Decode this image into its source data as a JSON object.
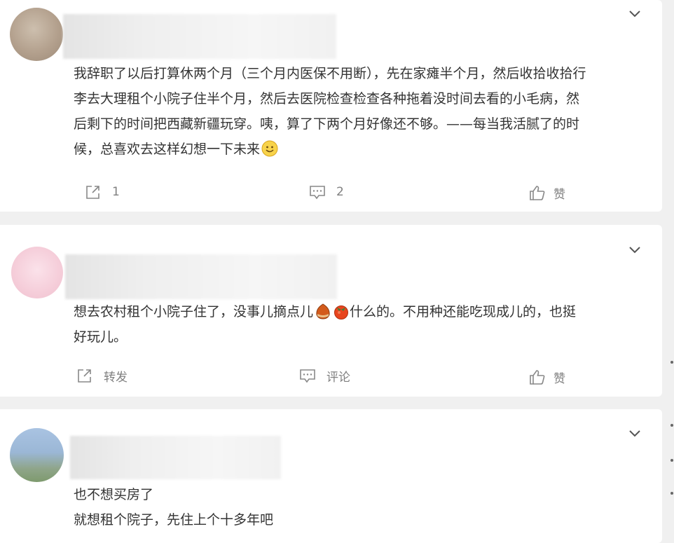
{
  "comments": [
    {
      "text_lines": [
        "我辞职了以后打算休两个月（三个月内医保不用断），先在家瘫半个月，然后收拾收拾行",
        "李去大理租个小院子住半个月，然后去医院检查检查各种拖着没时间去看的小毛病，然",
        "后剩下的时间把西藏新疆玩穿。咦，算了下两个月好像还不够。——每当我活腻了的时",
        "候，总喜欢去这样幻想一下未来"
      ],
      "emoji_icon": "smile-emoji",
      "repost_label": "1",
      "comment_label": "2",
      "like_label": "赞"
    },
    {
      "text_lines": [
        "想去农村租个小院子住了，没事儿摘点儿",
        "什么的。不用种还能吃现成儿的，也挺",
        "好玩儿。"
      ],
      "emoji_icons": [
        "chestnut-emoji",
        "persimmon-emoji"
      ],
      "repost_label": "转发",
      "comment_label": "评论",
      "like_label": "赞"
    },
    {
      "text_lines": [
        "也不想买房了",
        "就想租个院子，先住上个十多年吧"
      ]
    }
  ],
  "colors": {
    "page_bg": "#f0f0f0",
    "card_bg": "#ffffff",
    "text": "#333333",
    "action_text": "#808080"
  }
}
